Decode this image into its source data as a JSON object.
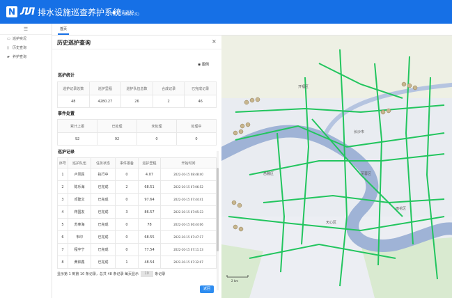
{
  "app": {
    "logo_letter": "N",
    "logo_mark": "ЛЛ",
    "title": "排水设施巡查养护系统",
    "title_sub": "(测试中文)",
    "menu_item": "历史巡护"
  },
  "sidebar": {
    "collapse_icon": "menu-icon",
    "items": [
      {
        "icon": "monitor-icon",
        "label": "巡护实况"
      },
      {
        "icon": "event-icon",
        "label": "历史查询"
      },
      {
        "icon": "route-icon",
        "label": "养护查询"
      }
    ]
  },
  "tabs": [
    {
      "label": "首页"
    }
  ],
  "panel": {
    "title": "历史巡护查询",
    "close": "×",
    "legend_label": "图例",
    "stats": {
      "title": "巡护统计",
      "headers": [
        "巡护记录总数",
        "巡护里程",
        "巡护队伍总数",
        "合成记录",
        "已完成记录"
      ],
      "values": [
        "48",
        "4280.27",
        "26",
        "2",
        "46"
      ]
    },
    "events": {
      "title": "事件处置",
      "headers": [
        "累计上报",
        "已处理",
        "未处理",
        "处理中"
      ],
      "values": [
        "92",
        "92",
        "0",
        "0"
      ]
    },
    "records": {
      "title": "巡护记录",
      "headers": [
        "序号",
        "巡护队伍",
        "任务状态",
        "事件报备",
        "巡护里程",
        "开始时间"
      ],
      "rows": [
        [
          "1",
          "卢凤民",
          "执行中",
          "0",
          "4.07",
          "2022-10-15 08:48:40"
        ],
        [
          "2",
          "陈乐海",
          "已完成",
          "2",
          "68.51",
          "2022-10-15 07:06:52"
        ],
        [
          "3",
          "邓建文",
          "已完成",
          "0",
          "97.64",
          "2022-10-15 07:44:41"
        ],
        [
          "4",
          "蒋国友",
          "已完成",
          "3",
          "86.57",
          "2022-10-15 07:05:33"
        ],
        [
          "5",
          "苏奉海",
          "已完成",
          "0",
          "78",
          "2022-10-15 06:44:06"
        ],
        [
          "6",
          "韦印",
          "已完成",
          "0",
          "68.55",
          "2022-10-15 07:47:17"
        ],
        [
          "7",
          "程宇宁",
          "已完成",
          "0",
          "77.54",
          "2022-10-15 07:11:13"
        ],
        [
          "8",
          "黄钟鑫",
          "已完成",
          "1",
          "48.54",
          "2022-10-15 07:32:07"
        ]
      ]
    },
    "pager": {
      "text_before": "显示第 1 到第 10 条记录，总共 48 条记录 每页显示",
      "select_value": "10",
      "text_after": "条记录"
    },
    "back_button": "返回"
  },
  "map": {
    "labels": [
      "长沙市",
      "开福区",
      "岳麓区",
      "芙蓉区",
      "天心区",
      "雨花区"
    ],
    "scale_label": "2 km"
  },
  "colors": {
    "brand": "#1670e6",
    "route": "#22c55e",
    "water": "#9fb3d6",
    "button": "#2d8cf0"
  }
}
